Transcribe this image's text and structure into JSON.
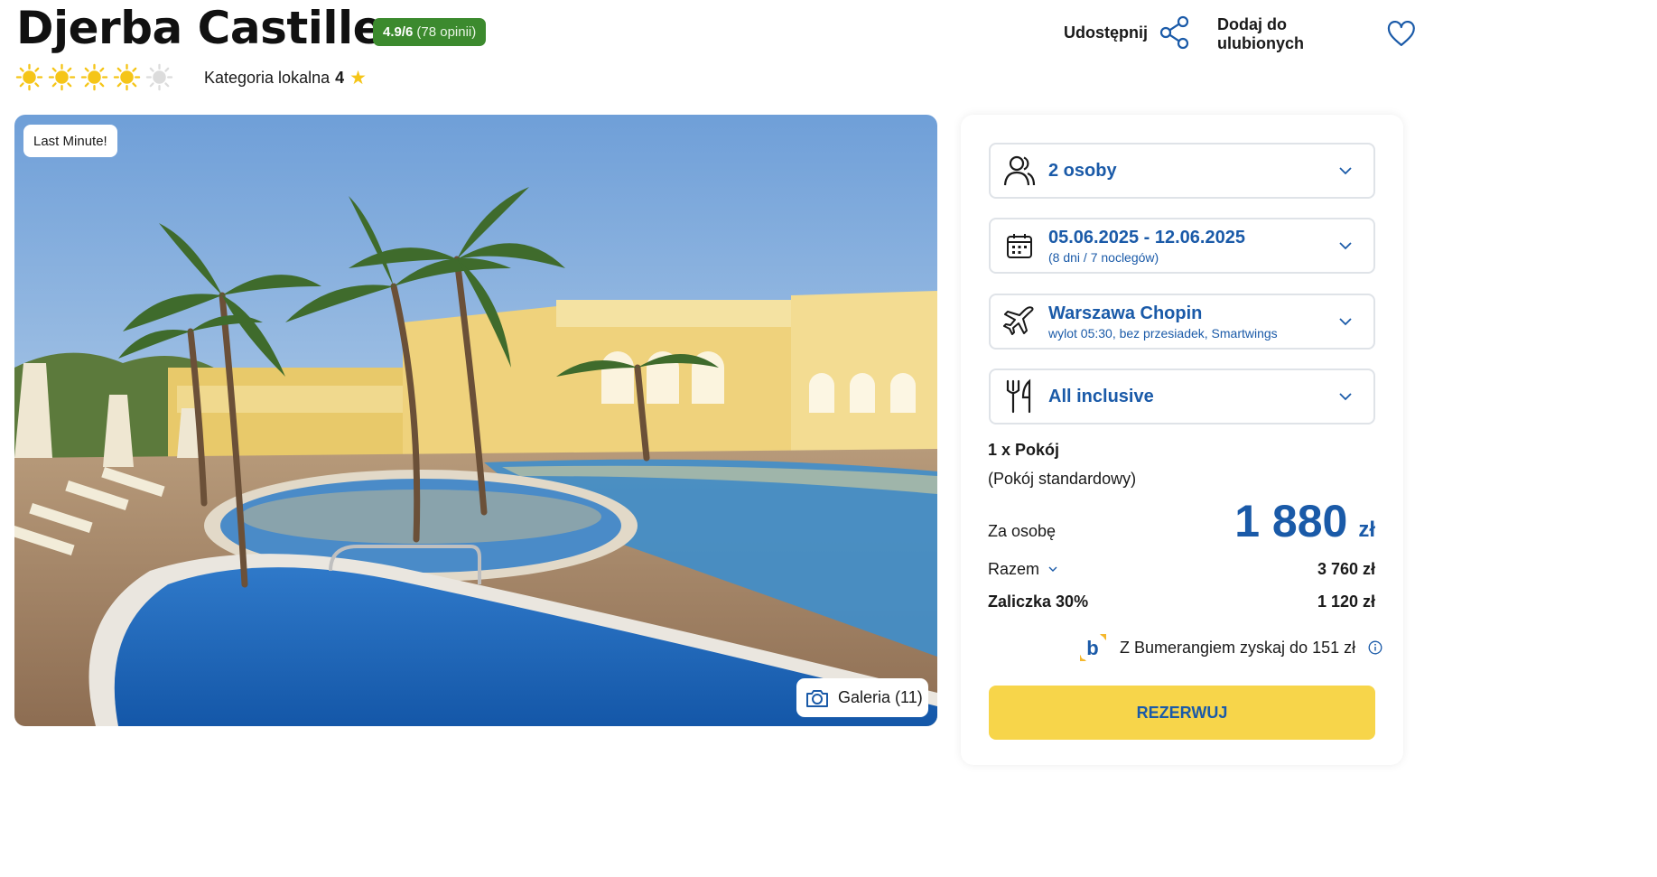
{
  "header": {
    "title": "Djerba Castille",
    "rating": "4.9/6",
    "reviews": "(78 opinii)",
    "sun_rating": 4,
    "sun_max": 5,
    "category_label": "Kategoria lokalna",
    "category_value": "4",
    "share_label": "Udostępnij",
    "favorite_label": "Dodaj do ulubionych"
  },
  "photo": {
    "badge": "Last Minute!",
    "gallery_label": "Galeria (11)"
  },
  "booking": {
    "persons": "2 osoby",
    "dates": "05.06.2025 - 12.06.2025",
    "dates_sub": "(8 dni / 7 noclegów)",
    "airport": "Warszawa Chopin",
    "flight_sub": "wylot 05:30, bez przesiadek, Smartwings",
    "board": "All inclusive",
    "room": "1 x Pokój",
    "room_type": "(Pokój standardowy)",
    "per_person_label": "Za osobę",
    "price": "1 880",
    "currency": "zł",
    "total_label": "Razem",
    "total_value": "3 760 zł",
    "deposit_label": "Zaliczka 30%",
    "deposit_value": "1 120 zł",
    "bumerang_text": "Z Bumerangiem zyskaj do 151 zł",
    "book_label": "REZERWUJ"
  },
  "colors": {
    "accent": "#1a5aa8",
    "rating_green": "#3c8a2e",
    "book_yellow": "#f7d54a",
    "sun": "#f5c518"
  }
}
